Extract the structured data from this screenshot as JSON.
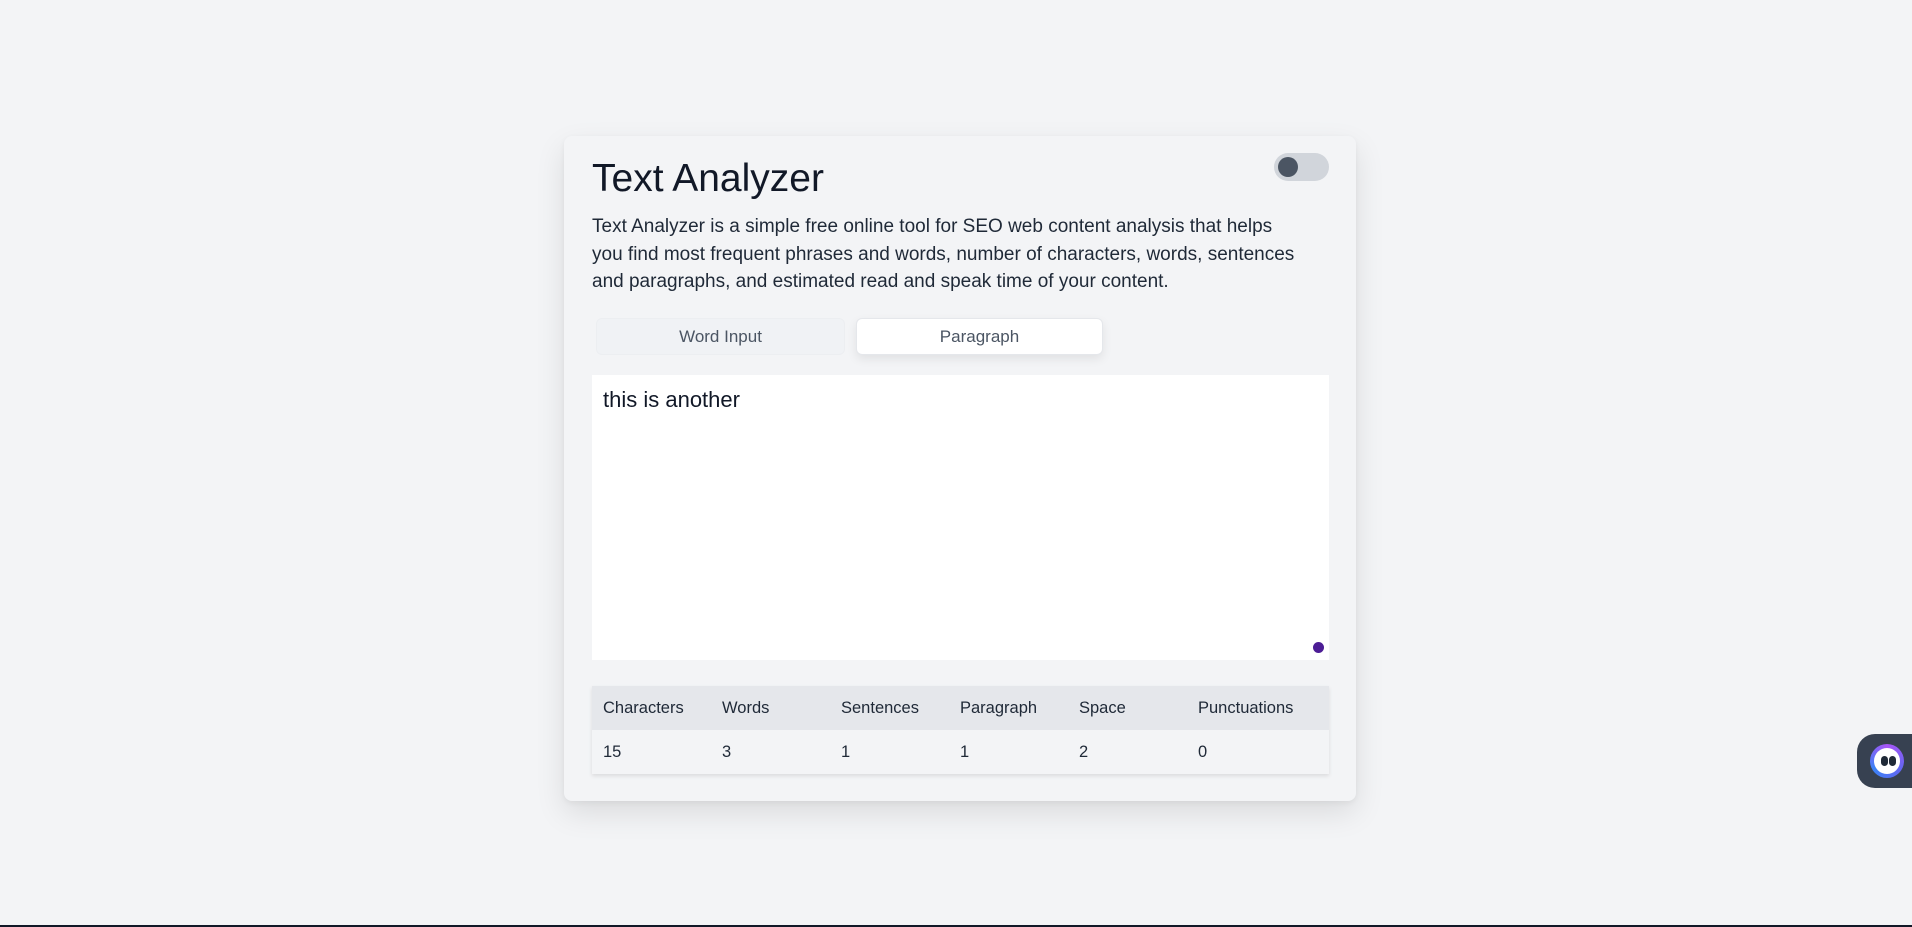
{
  "app": {
    "title": "Text Analyzer",
    "description": "Text Analyzer is a simple free online tool for SEO web content analysis that helps you find most frequent phrases and words, number of characters, words, sentences and paragraphs, and estimated read and speak time of your content."
  },
  "theme_toggle": {
    "state": "off",
    "icon": "toggle-icon"
  },
  "tabs": [
    {
      "label": "Word Input",
      "active": false
    },
    {
      "label": "Paragraph",
      "active": true
    }
  ],
  "editor": {
    "value": "this is another"
  },
  "stats": {
    "headers": [
      "Characters",
      "Words",
      "Sentences",
      "Paragraph",
      "Space",
      "Punctuations"
    ],
    "values": [
      "15",
      "3",
      "1",
      "1",
      "2",
      "0"
    ]
  },
  "assistant": {
    "icon": "assistant-face-icon"
  },
  "colors": {
    "background": "#f3f4f6",
    "accent_dot": "#4c1d95",
    "toggle_track": "#d1d5db",
    "toggle_knob": "#4b5563"
  }
}
